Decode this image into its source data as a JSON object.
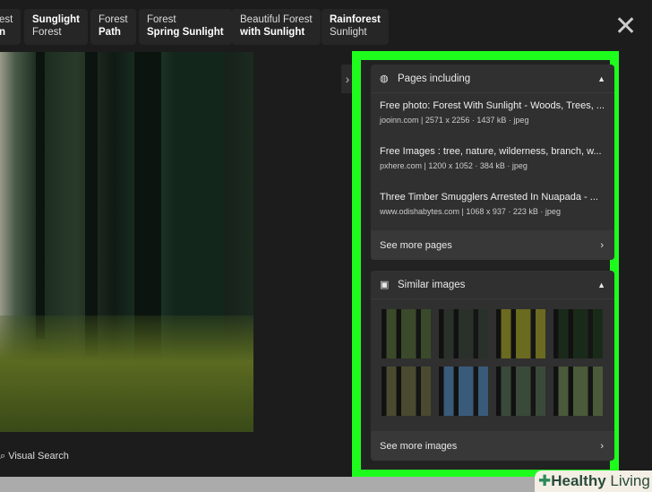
{
  "chips": [
    {
      "top": "est",
      "bottom": "n"
    },
    {
      "top": "Sunglight",
      "bottom": "Forest"
    },
    {
      "top": "Forest",
      "bottom": "Path"
    },
    {
      "top": "Forest",
      "bottom": "Spring Sunlight"
    },
    {
      "top": "Beautiful Forest",
      "bottom": "with Sunlight"
    },
    {
      "top": "Rainforest",
      "bottom": "Sunlight"
    }
  ],
  "visual_search": "Visual Search",
  "pages": {
    "title": "Pages including",
    "items": [
      {
        "title": "Free photo: Forest With Sunlight - Woods, Trees, ...",
        "meta": "jooinn.com | 2571 x 2256 · 1437 kB · jpeg"
      },
      {
        "title": "Free Images : tree, nature, wilderness, branch, w...",
        "meta": "pxhere.com | 1200 x 1052 · 384 kB · jpeg"
      },
      {
        "title": "Three Timber Smugglers Arrested In Nuapada - ...",
        "meta": "www.odishabytes.com | 1068 x 937 · 223 kB · jpeg"
      }
    ],
    "more": "See more pages"
  },
  "similar": {
    "title": "Similar images",
    "more": "See more images",
    "thumbs": [
      "#3a4a2a",
      "#2a302a",
      "#6a6a20",
      "#1a2a1a",
      "#4a4a30",
      "#3a5a7a",
      "#3a4a3a",
      "#4a5a3a"
    ]
  },
  "watermark": {
    "bold": "Healthy",
    "light": "Living"
  }
}
